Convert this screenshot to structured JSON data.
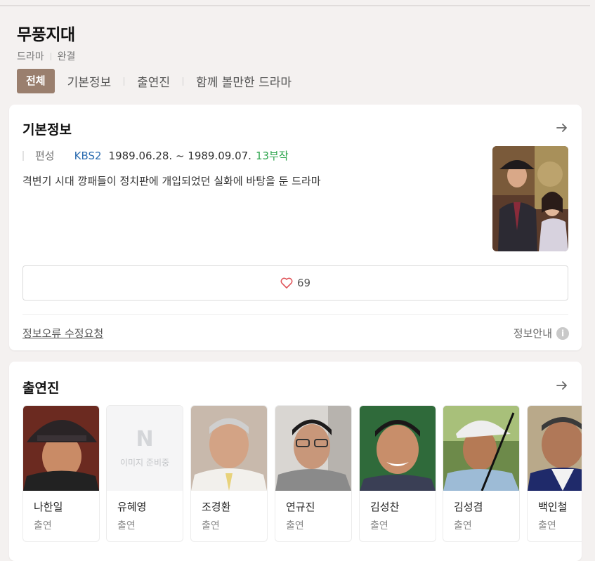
{
  "title": "무풍지대",
  "meta": {
    "genre": "드라마",
    "status": "완결"
  },
  "tabs": [
    {
      "label": "전체",
      "active": true
    },
    {
      "label": "기본정보"
    },
    {
      "label": "출연진"
    },
    {
      "label": "함께 볼만한 드라마"
    }
  ],
  "basic_info": {
    "heading": "기본정보",
    "label": "편성",
    "channel": "KBS2",
    "dates": "1989.06.28. ~ 1989.09.07.",
    "episodes": "13부작",
    "description": "격변기 시대 깡패들이 정치판에 개입되었던 실화에 바탕을 둔 드라마",
    "likes": "69",
    "report_link": "정보오류 수정요청",
    "guide_link": "정보안내",
    "guide_icon": "i"
  },
  "cast": {
    "heading": "출연진",
    "placeholder_logo": "N",
    "placeholder_text": "이미지 준비중",
    "members": [
      {
        "name": "나한일",
        "role": "출연"
      },
      {
        "name": "유혜영",
        "role": "출연"
      },
      {
        "name": "조경환",
        "role": "출연"
      },
      {
        "name": "연규진",
        "role": "출연"
      },
      {
        "name": "김성찬",
        "role": "출연"
      },
      {
        "name": "김성겸",
        "role": "출연"
      },
      {
        "name": "백인철",
        "role": "출연"
      }
    ]
  },
  "colors": {
    "accent_tab": "#9a7f6e",
    "channel": "#2b6cb0",
    "episodes": "#2ca44c",
    "heart": "#e0565b"
  }
}
